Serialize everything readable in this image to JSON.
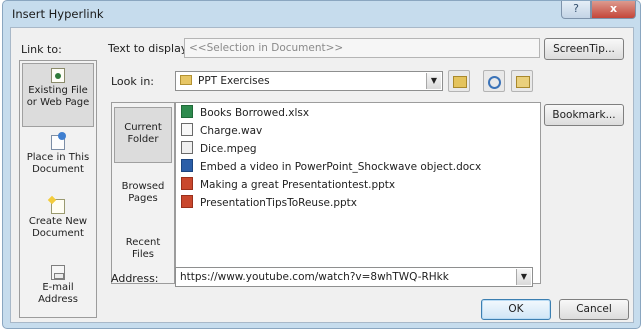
{
  "window": {
    "title": "Insert Hyperlink",
    "help_label": "?",
    "close_label": "x"
  },
  "link_to": {
    "label": "Link to:",
    "items": [
      {
        "label": "Existing File or Web Page",
        "icon": "web-page-icon",
        "active": true
      },
      {
        "label": "Place in This Document",
        "icon": "document-place-icon",
        "active": false
      },
      {
        "label": "Create New Document",
        "icon": "new-document-icon",
        "active": false
      },
      {
        "label": "E-mail Address",
        "icon": "email-icon",
        "active": false
      }
    ]
  },
  "text_to_display": {
    "label": "Text to display:",
    "value": "<<Selection in Document>>"
  },
  "screentip_label": "ScreenTip...",
  "look_in": {
    "label": "Look in:",
    "value": "PPT Exercises"
  },
  "sub_places": [
    {
      "label": "Current Folder",
      "active": true
    },
    {
      "label": "Browsed Pages",
      "active": false
    },
    {
      "label": "Recent Files",
      "active": false
    }
  ],
  "files": [
    {
      "name": "Books Borrowed.xlsx",
      "type": "xlsx"
    },
    {
      "name": "Charge.wav",
      "type": "wav"
    },
    {
      "name": "Dice.mpeg",
      "type": "mpeg"
    },
    {
      "name": "Embed a video in PowerPoint_Shockwave object.docx",
      "type": "docx"
    },
    {
      "name": "Making a great Presentationtest.pptx",
      "type": "pptx"
    },
    {
      "name": "PresentationTipsToReuse.pptx",
      "type": "pptx"
    }
  ],
  "bookmark_label": "Bookmark...",
  "address": {
    "label": "Address:",
    "value": "https://www.youtube.com/watch?v=8whTWQ-RHkk"
  },
  "ok_label": "OK",
  "cancel_label": "Cancel"
}
